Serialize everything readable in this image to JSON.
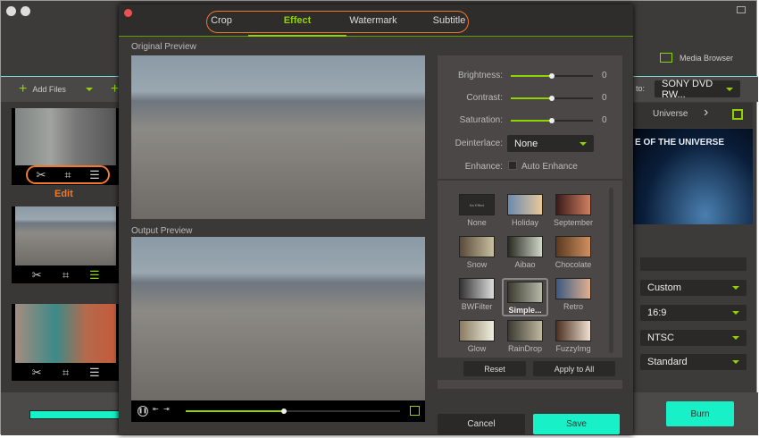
{
  "app": {
    "toolbar": {
      "add_files": "Add Files",
      "media_browser": "Media Browser",
      "to_label": "to:",
      "device": "SONY DVD RW..."
    },
    "files": [
      {
        "edit_label": "Edit"
      },
      {},
      {}
    ],
    "template": {
      "name": "Universe",
      "banner_text": "E OF THE UNIVERSE"
    },
    "settings": [
      "Custom",
      "16:9",
      "NTSC",
      "Standard"
    ],
    "burn": "Burn",
    "progress": 0.0
  },
  "dialog": {
    "tabs": [
      "Crop",
      "Effect",
      "Watermark",
      "Subtitle"
    ],
    "active_tab": "Effect",
    "original_preview": "Original Preview",
    "output_preview": "Output Preview",
    "playback_progress": 0.46,
    "adjust": [
      {
        "label": "Brightness:",
        "value": "0",
        "level": 0.5
      },
      {
        "label": "Contrast:",
        "value": "0",
        "level": 0.5
      },
      {
        "label": "Saturation:",
        "value": "0",
        "level": 0.5
      }
    ],
    "deinterlace_label": "Deinterlace:",
    "deinterlace": "None",
    "enhance_label": "Enhance:",
    "auto_enhance": "Auto Enhance",
    "no_effect_text": "No Effect",
    "effects": [
      "None",
      "Holiday",
      "September",
      "Snow",
      "Aibao",
      "Chocolate",
      "BWFilter",
      "Simple...",
      "Retro",
      "Glow",
      "RainDrop",
      "FuzzyImg"
    ],
    "selected_effect": "Simple...",
    "reset": "Reset",
    "apply_all": "Apply to All",
    "cancel": "Cancel",
    "save": "Save"
  },
  "colors": {
    "accent": "#8fd400",
    "teal": "#18f0c8",
    "highlight": "#f07a2a"
  }
}
